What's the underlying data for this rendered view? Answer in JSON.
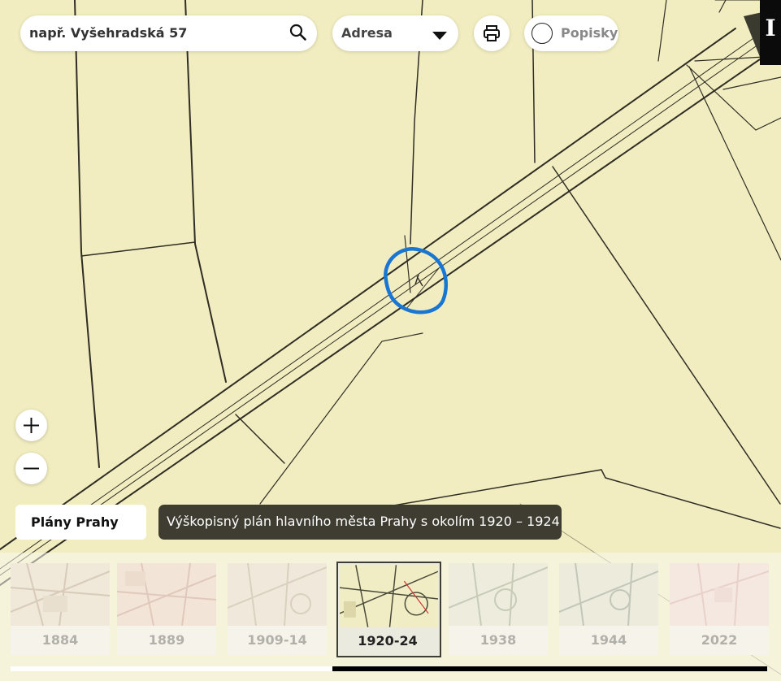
{
  "search": {
    "placeholder": "např. Vyšehradská 57"
  },
  "layer_select": {
    "value": "Adresa"
  },
  "labels_toggle": {
    "label": "Popisky",
    "checked": false
  },
  "info_button": {
    "label": "I"
  },
  "zoom": {
    "in_label": "+",
    "out_label": "−"
  },
  "plans_button": {
    "label": "Plány Prahy"
  },
  "map_tooltip": {
    "text": "Výškopisný plán hlavního města Prahy s okolím 1920 – 1924"
  },
  "timeline": {
    "items": [
      {
        "label": "1884",
        "selected": false
      },
      {
        "label": "1889",
        "selected": false
      },
      {
        "label": "1909-14",
        "selected": false
      },
      {
        "label": "1920-24",
        "selected": true
      },
      {
        "label": "1938",
        "selected": false
      },
      {
        "label": "1944",
        "selected": false
      },
      {
        "label": "2022",
        "selected": false
      }
    ],
    "scroll_window": {
      "start": 0.425,
      "end": 1.0
    }
  },
  "colors": {
    "map_paper": "#f1edc0",
    "marker": "#1976d2",
    "tooltip_bg": "#3f3c32",
    "selected_border": "#3e3e38"
  }
}
